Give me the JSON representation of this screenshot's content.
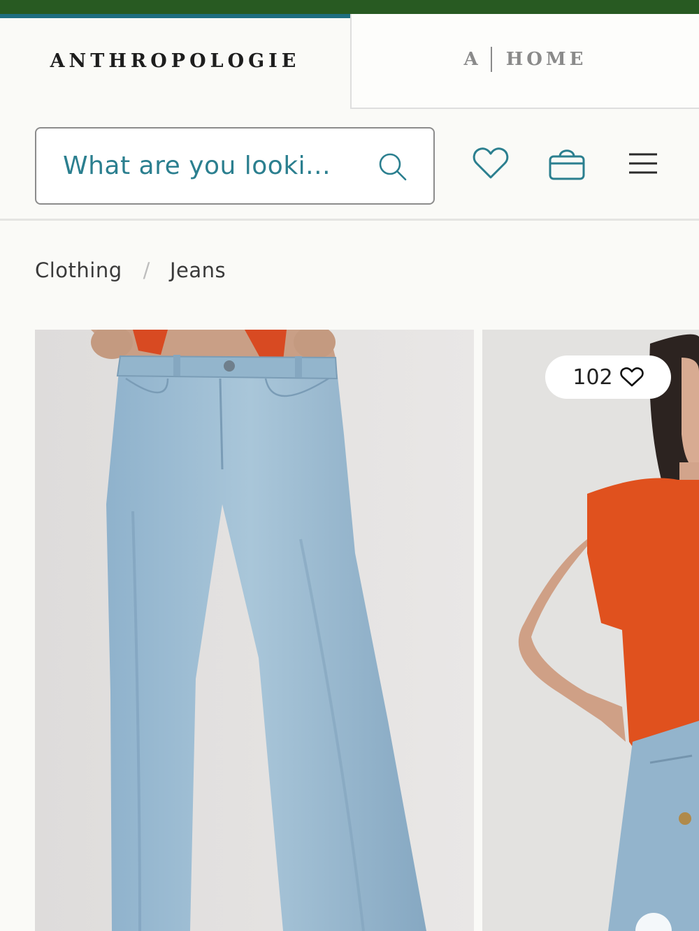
{
  "tabs": {
    "anthropologie": "ANTHROPOLOGIE",
    "home_a": "A",
    "home_label": "HOME"
  },
  "header": {
    "search_placeholder": "What are you looki...",
    "icons": [
      "search-icon",
      "heart-icon",
      "bag-icon",
      "menu-icon"
    ]
  },
  "breadcrumb": {
    "items": [
      "Clothing",
      "Jeans"
    ],
    "separator": "/"
  },
  "products": [
    {
      "image": "light-wash-straight-jeans"
    },
    {
      "image": "model-orange-top-jeans",
      "favorites": "102"
    }
  ],
  "colors": {
    "brand_green": "#285a22",
    "accent_teal": "#1e6e80",
    "link_teal": "#2b7f8f"
  }
}
